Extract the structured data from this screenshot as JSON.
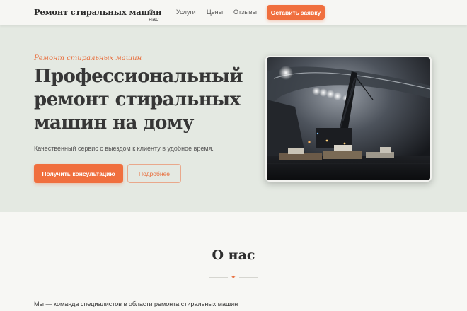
{
  "header": {
    "logo": "Ремонт стиральных машин",
    "nav": [
      "О нас",
      "Услуги",
      "Цены",
      "Отзывы"
    ],
    "cta": "Оставить заявку"
  },
  "hero": {
    "kicker": "Ремонт стиральных машин",
    "title": "Профессиональный ремонт стиральных машин на дому",
    "subtitle": "Качественный сервис с выездом к клиенту в удобное время.",
    "primary_button": "Получить консультацию",
    "secondary_button": "Подробнее"
  },
  "about": {
    "title": "О нас",
    "text": "Мы — команда специалистов в области ремонта стиральных машин"
  },
  "colors": {
    "accent": "#f06f3e",
    "hero_bg": "#e4e9e2",
    "page_bg": "#f7f7f4"
  }
}
